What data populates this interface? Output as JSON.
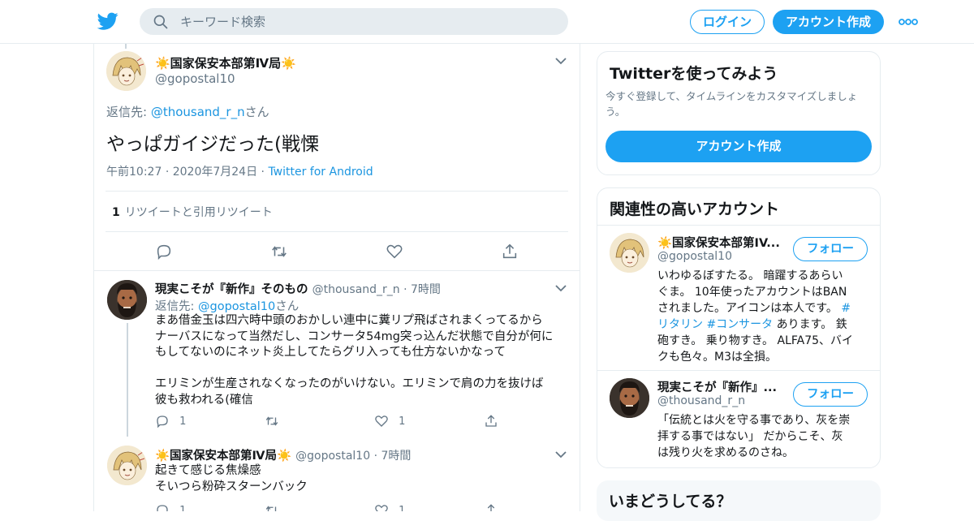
{
  "header": {
    "search_placeholder": "キーワード検索",
    "login_label": "ログイン",
    "signup_label": "アカウント作成",
    "brand_color": "#1da1f2"
  },
  "main_tweet": {
    "name": "☀️国家保安本部第Ⅳ局☀️",
    "handle": "@gopostal10",
    "reply_prefix": "返信先: ",
    "reply_handle": "@thousand_r_n",
    "reply_suffix": "さん",
    "text": "やっぱガイジだった(戦慄",
    "time": "午前10:27",
    "date": "2020年7月24日",
    "source": "Twitter for Android",
    "retweet_count": "1",
    "retweet_label": "リツイートと引用リツイート"
  },
  "replies": [
    {
      "name": "現実こそが『新作』そのもの",
      "handle": "@thousand_r_n",
      "time": "7時間",
      "reply_prefix": "返信先: ",
      "reply_handle": "@gopostal10",
      "reply_suffix": "さん",
      "text_lines": [
        "まあ借金玉は四六時中頭のおかしい連中に糞リプ飛ばされまくってるから",
        "ナーバスになって当然だし、コンサータ54mg突っ込んだ状態で自分が何に",
        "もしてないのにネット炎上してたらグリ入っても仕方ないかなって",
        "",
        "エリミンが生産されなくなったのがいけない。エリミンで肩の力を抜けば",
        "彼も救われる(確信"
      ],
      "reply_count": "1",
      "like_count": "1"
    },
    {
      "name": "☀️国家保安本部第Ⅳ局☀️",
      "handle": "@gopostal10",
      "time": "7時間",
      "text_lines": [
        "起きて感じる焦燥感",
        "そいつら粉砕スターンバック"
      ],
      "reply_count": "1",
      "like_count": "1"
    }
  ],
  "sidebar": {
    "signup_card": {
      "title": "Twitterを使ってみよう",
      "subtitle_line1": "今すぐ登録して、タイムラインをカスタマイズしましょ",
      "subtitle_line2": "う。",
      "button": "アカウント作成"
    },
    "related": {
      "title": "関連性の高いアカウント",
      "accounts": [
        {
          "name": "☀️国家保安本部第IV...",
          "handle": "@gopostal10",
          "follow_label": "フォロー",
          "bio_line1": "いわゆるぼすたる。 暗躍するあらい",
          "bio_line2": "ぐま。 10年使ったアカウントはBAN",
          "bio_line3a": "されました。アイコンは本人です。 ",
          "bio_tag1": "#",
          "bio_line4_tag1": "リタリン",
          "bio_tag2": "#コンサータ",
          "bio_line4_rest": " あります。 鉄",
          "bio_line5": "砲すき。 乗り物すき。 ALFA75、バイ",
          "bio_line6": "クも色々。M3は全損。"
        },
        {
          "name": "現実こそが『新作』...",
          "handle": "@thousand_r_n",
          "follow_label": "フォロー",
          "bio_line1": "「伝統とは火を守る事であり、灰を崇",
          "bio_line2": "拝する事ではない」 だからこそ、灰",
          "bio_line3": "は残り火を求めるのさね。"
        }
      ]
    },
    "trends_title": "いまどうしてる？"
  }
}
